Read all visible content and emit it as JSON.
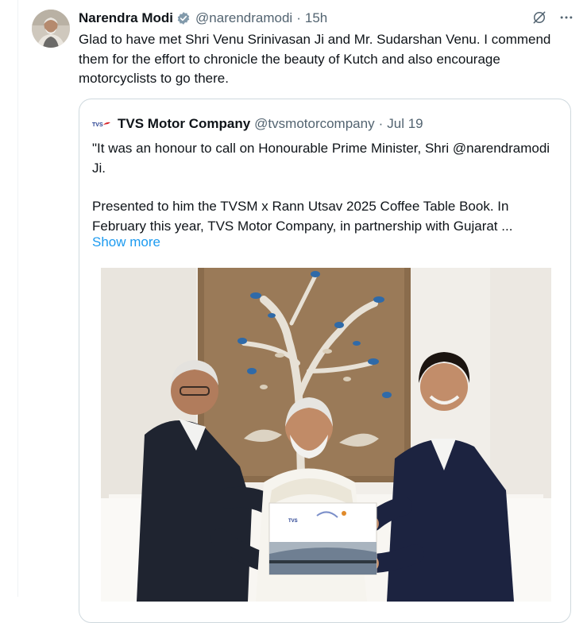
{
  "tweet": {
    "author_name": "Narendra Modi",
    "author_handle": "@narendramodi",
    "time": "15h",
    "text": "Glad to have met Shri Venu Srinivasan Ji and Mr. Sudarshan Venu. I commend them for the effort to chronicle the beauty of Kutch and also encourage motorcyclists to go there."
  },
  "quoted": {
    "author_name": "TVS Motor Company",
    "author_handle": "@tvsmotorcompany",
    "time": "Jul 19",
    "paragraph1": "\"It was an honour to call on Honourable Prime Minister, Shri @narendramodi Ji.",
    "paragraph2": "Presented to him the TVSM x Rann Utsav 2025 Coffee Table Book. In February this year, TVS Motor Company, in partnership with Gujarat ...",
    "show_more": "Show more",
    "book_logo_text": "TVS"
  },
  "icons": {
    "verified": "verified-badge-icon",
    "grok": "grok-icon",
    "more": "more-icon"
  },
  "colors": {
    "link": "#1d9bf0",
    "muted": "#536471",
    "verified": "#829aab",
    "border": "#cfd9de"
  }
}
